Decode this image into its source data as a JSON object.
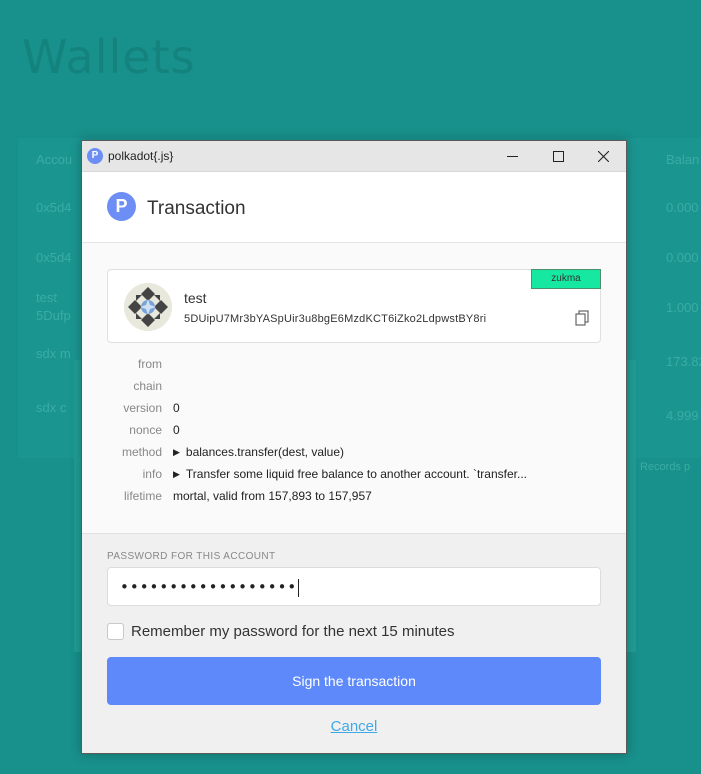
{
  "background": {
    "title": "Wallets",
    "columns": [
      "Accou",
      "Balan"
    ],
    "rows": [
      {
        "a": "0x5d4",
        "b": "0.000"
      },
      {
        "a": "0x5d4",
        "b": "0.000"
      },
      {
        "a": "test",
        "a2": "5Dufp",
        "b": "1.000"
      },
      {
        "a": "sdx m",
        "b": "173.82"
      },
      {
        "a": "sdx c",
        "b": "4.999"
      }
    ],
    "records_text": "Records p"
  },
  "window": {
    "title": "polkadot{.js}",
    "logo_glyph": "P"
  },
  "header": {
    "title": "Transaction"
  },
  "account": {
    "name": "test",
    "address": "5DUipU7Mr3bYASpUir3u8bgE6MzdKCT6iZko2LdpwstBY8ri",
    "tag": "zukma",
    "tag_color": "#16e8a2"
  },
  "details": [
    {
      "label": "from",
      "value": ""
    },
    {
      "label": "chain",
      "value": ""
    },
    {
      "label": "version",
      "value": "0"
    },
    {
      "label": "nonce",
      "value": "0"
    },
    {
      "label": "method",
      "value": "balances.transfer(dest, value)",
      "expandable": true
    },
    {
      "label": "info",
      "value": "Transfer some liquid free balance to another account. `transfer...",
      "expandable": true
    },
    {
      "label": "lifetime",
      "value": "mortal, valid from 157,893 to 157,957"
    }
  ],
  "password": {
    "label": "PASSWORD FOR THIS ACCOUNT",
    "masked_value": "••••••••••••••••••"
  },
  "remember": {
    "label": "Remember my password for the next 15 minutes",
    "checked": false
  },
  "sign_button": {
    "label": "Sign the transaction",
    "color": "#5e89fb"
  },
  "cancel": {
    "label": "Cancel"
  },
  "colors": {
    "background": "#1a9a94",
    "accent": "#6c8ef5"
  }
}
